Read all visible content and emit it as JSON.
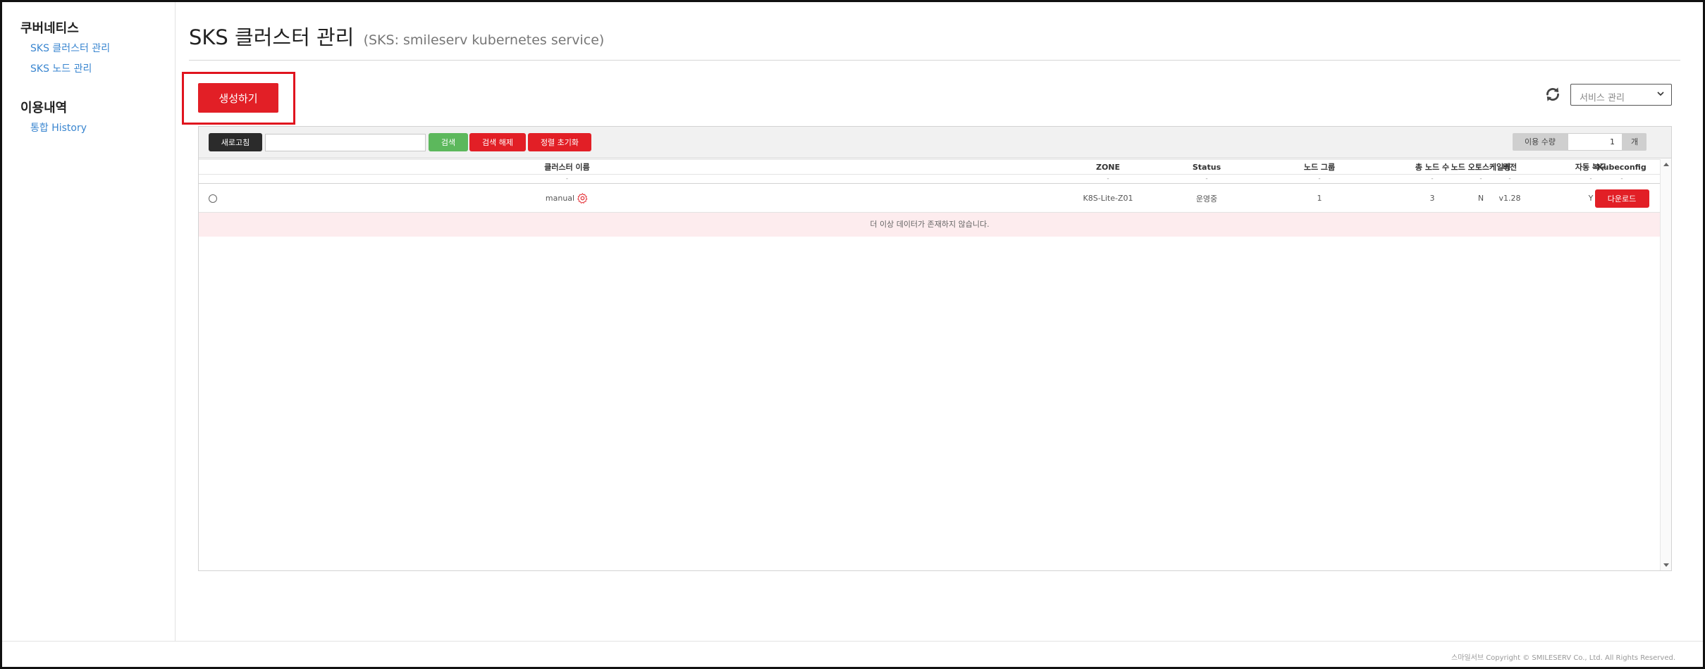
{
  "sidebar": {
    "sections": [
      {
        "title": "쿠버네티스",
        "items": [
          {
            "label": "SKS 클러스터 관리"
          },
          {
            "label": "SKS 노드 관리"
          }
        ]
      },
      {
        "title": "이용내역",
        "items": [
          {
            "label": "통합 History"
          }
        ]
      }
    ]
  },
  "header": {
    "title": "SKS 클러스터 관리",
    "subtitle": "(SKS: smileserv kubernetes service)"
  },
  "actions": {
    "create_label": "생성하기",
    "service_select": {
      "value": "서비스 관리"
    },
    "refresh_icon": "refresh-icon"
  },
  "toolbar": {
    "refresh_label": "새로고침",
    "search_placeholder": "",
    "search_label": "검색",
    "clear_search_label": "검색 해제",
    "reset_sort_label": "정렬 초기화",
    "usage_label": "이용 수량",
    "usage_value": "1",
    "usage_unit": "개"
  },
  "table": {
    "columns": [
      "",
      "클러스터 이름",
      "ZONE",
      "Status",
      "노드 그룹",
      "총 노드 수",
      "버전",
      "자동 복구",
      "노드 오토스케일링",
      "Kubeconfig"
    ],
    "filter_marks": [
      "",
      "-",
      "-",
      "-",
      "-",
      "-",
      "-",
      "-",
      "-",
      "-"
    ],
    "rows": [
      {
        "name": "manual",
        "zone": "K8S-Lite-Z01",
        "status": "운영중",
        "node_groups": "1",
        "total_nodes": "3",
        "version": "v1.28",
        "auto_recovery": "Y",
        "autoscaling": "N",
        "kubeconfig_label": "다운로드"
      }
    ],
    "empty_message": "더 이상 데이터가 존재하지 않습니다."
  },
  "footer": {
    "copyright": "스마일서브 Copyright © SMILESERV Co., Ltd. All Rights Reserved."
  },
  "colors": {
    "accent_red": "#e21f26",
    "search_green": "#5cb85c",
    "dark_button": "#2b2b2b",
    "link_blue": "#3a86d0",
    "empty_row_bg": "#fdecee"
  }
}
